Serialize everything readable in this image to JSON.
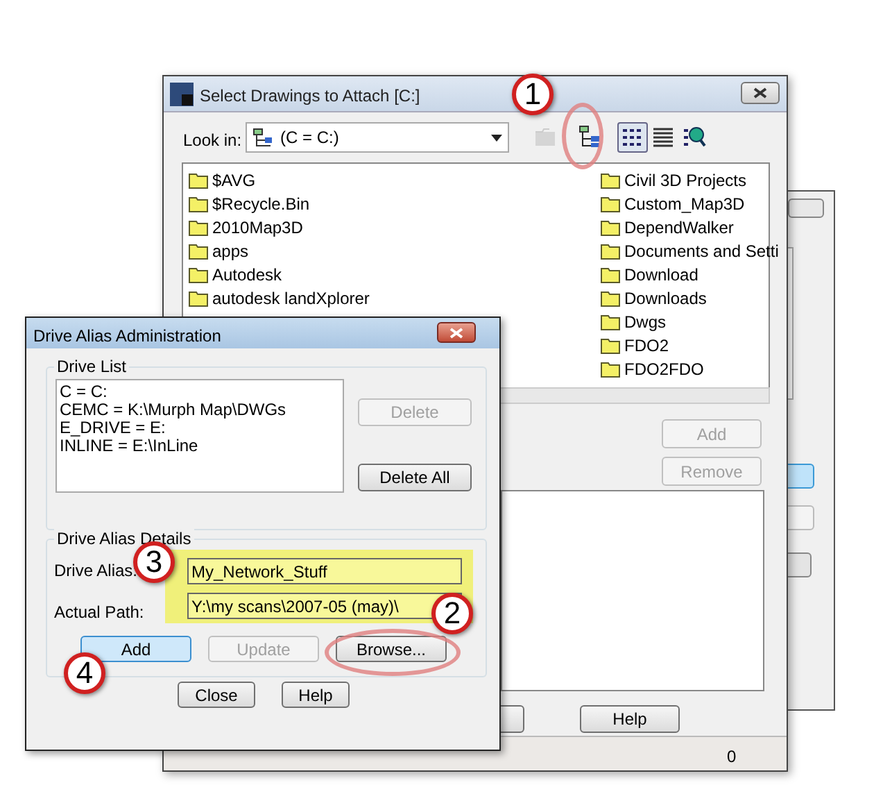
{
  "main_window": {
    "title": "Select Drawings to Attach [C:]",
    "look_in": {
      "label": "Look in:",
      "value": "(C = C:)"
    },
    "view_buttons": [
      {
        "kind": "up",
        "disabled": true,
        "selected": false
      },
      {
        "kind": "tree",
        "disabled": false,
        "selected": false
      },
      {
        "kind": "list",
        "disabled": false,
        "selected": true
      },
      {
        "kind": "details",
        "disabled": false,
        "selected": false
      },
      {
        "kind": "find",
        "disabled": false,
        "selected": false
      }
    ],
    "folders_left": [
      "$AVG",
      "$Recycle.Bin",
      "2010Map3D",
      "apps",
      "Autodesk",
      "autodesk landXplorer"
    ],
    "folders_right": [
      "Civil 3D Projects",
      "Custom_Map3D",
      "DependWalker",
      "Documents and Setti",
      "Download",
      "Downloads",
      "Dwgs",
      "FDO2",
      "FDO2FDO"
    ],
    "buttons": [
      {
        "label": "Add",
        "disabled": true
      },
      {
        "label": "Remove",
        "disabled": true
      }
    ],
    "help_button": "Help",
    "status": "0"
  },
  "dialog": {
    "title": "Drive Alias Administration",
    "drive_list": {
      "legend": "Drive List",
      "items": [
        "C = C:",
        "CEMC = K:\\Murph Map\\DWGs",
        "E_DRIVE = E:",
        "INLINE = E:\\InLine"
      ],
      "delete": {
        "label": "Delete",
        "disabled": true
      },
      "delete_all": {
        "label": "Delete All",
        "disabled": false
      }
    },
    "details": {
      "legend": "Drive Alias Details",
      "alias_label": "Drive Alias:",
      "alias_value": "My_Network_Stuff",
      "path_label": "Actual Path:",
      "path_value": "Y:\\my scans\\2007-05 (may)\\",
      "buttons": [
        {
          "label": "Add",
          "disabled": false,
          "default": true
        },
        {
          "label": "Update",
          "disabled": true,
          "default": false
        },
        {
          "label": "Browse...",
          "disabled": false,
          "default": false
        }
      ]
    },
    "close": "Close",
    "help": "Help"
  },
  "callouts": [
    "1",
    "2",
    "3",
    "4"
  ]
}
